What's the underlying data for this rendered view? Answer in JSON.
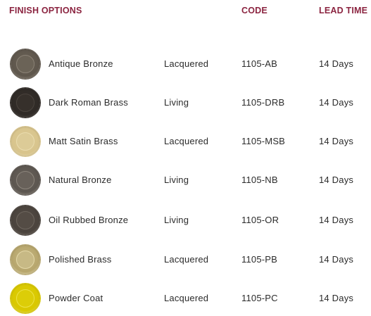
{
  "headers": {
    "finish": "FINISH OPTIONS",
    "code": "CODE",
    "lead_time": "LEAD TIME"
  },
  "colors": {
    "header": "#8b2440"
  },
  "rows": [
    {
      "name": "Antique Bronze",
      "type": "Lacquered",
      "code": "1105-AB",
      "lead": "14 Days",
      "swatch": "#5e564c",
      "swatch_ring": "#8a8175",
      "swatch_center": "#6b6357"
    },
    {
      "name": "Dark Roman Brass",
      "type": "Living",
      "code": "1105-DRB",
      "lead": "14 Days",
      "swatch": "#2f2a26",
      "swatch_ring": "#4a433d",
      "swatch_center": "#36302b"
    },
    {
      "name": "Matt Satin Brass",
      "type": "Lacquered",
      "code": "1105-MSB",
      "lead": "14 Days",
      "swatch": "#d8c48c",
      "swatch_ring": "#eadcae",
      "swatch_center": "#dccb97"
    },
    {
      "name": "Natural Bronze",
      "type": "Living",
      "code": "1105-NB",
      "lead": "14 Days",
      "swatch": "#5c5650",
      "swatch_ring": "#8c857c",
      "swatch_center": "#68615a"
    },
    {
      "name": "Oil Rubbed Bronze",
      "type": "Living",
      "code": "1105-OR",
      "lead": "14 Days",
      "swatch": "#4a433d",
      "swatch_ring": "#6e665e",
      "swatch_center": "#544c45"
    },
    {
      "name": "Polished Brass",
      "type": "Lacquered",
      "code": "1105-PB",
      "lead": "14 Days",
      "swatch": "#b6a56c",
      "swatch_ring": "#e4d8a8",
      "swatch_center": "#c7b985"
    },
    {
      "name": "Powder Coat",
      "type": "Lacquered",
      "code": "1105-PC",
      "lead": "14 Days",
      "swatch": "#d9c800",
      "swatch_ring": "#ece24a",
      "swatch_center": "#dccd08"
    }
  ]
}
